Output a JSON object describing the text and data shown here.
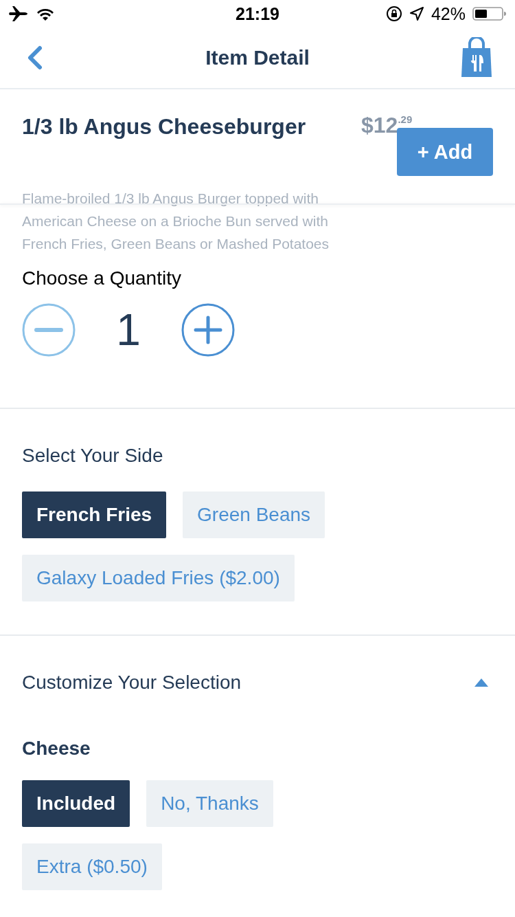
{
  "status_bar": {
    "time": "21:19",
    "battery": "42%"
  },
  "nav": {
    "title": "Item Detail"
  },
  "item": {
    "name": "1/3 lb Angus Cheeseburger",
    "price": "$12",
    "price_cents": ".29",
    "add_button": "+ Add",
    "description": "Flame-broiled 1/3 lb Angus Burger topped with American Cheese on a Brioche Bun served with French Fries, Green Beans or Mashed Potatoes"
  },
  "quantity": {
    "label": "Choose a Quantity",
    "value": "1",
    "decrement_disabled": true
  },
  "side": {
    "title": "Select Your Side",
    "options": [
      {
        "label": "French Fries",
        "selected": true
      },
      {
        "label": "Green Beans",
        "selected": false
      },
      {
        "label": "Galaxy Loaded Fries ($2.00)",
        "selected": false
      }
    ]
  },
  "customize": {
    "title": "Customize Your Selection",
    "expanded": true,
    "groups": [
      {
        "title": "Cheese",
        "options": [
          {
            "label": "Included",
            "selected": true
          },
          {
            "label": "No, Thanks",
            "selected": false
          },
          {
            "label": "Extra ($0.50)",
            "selected": false
          }
        ]
      }
    ]
  }
}
